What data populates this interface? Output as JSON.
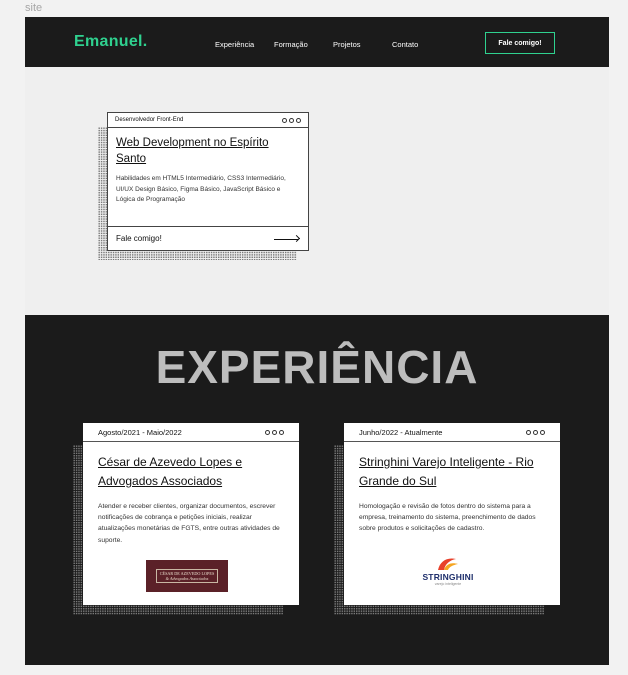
{
  "frame_label": "site",
  "header": {
    "logo": "Emanuel.",
    "nav": [
      "Experiência",
      "Formação",
      "Projetos",
      "Contato"
    ],
    "cta": "Fale comigo!"
  },
  "hero": {
    "tag": "Desenvolvedor Front-End",
    "title": "Web Development no Espírito Santo",
    "description": "Habilidades em HTML5 Intermediário, CSS3 Intermediário, UI/UX Design Básico, Figma Básico, JavaScript Básico e Lógica de Programação",
    "cta": "Fale comigo!"
  },
  "experience": {
    "heading": "EXPERIÊNCIA",
    "items": [
      {
        "period": "Agosto/2021 - Maio/2022",
        "title": "César de Azevedo Lopes e Advogados Associados",
        "description": "Atender e receber clientes, organizar documentos, escrever notificações de cobrança e petições iniciais, realizar atualizações monetárias de FGTS, entre outras atividades de suporte.",
        "logo_lines": [
          "CÉSAR DE AZEVEDO LOPES",
          "& Advogados Associados"
        ]
      },
      {
        "period": "Junho/2022 - Atualmente",
        "title": "Stringhini Varejo Inteligente - Rio Grande do Sul",
        "description": "Homologação e revisão de fotos dentro do sistema para a empresa, treinamento do sistema, preenchimento de dados sobre produtos e solicitações de cadastro.",
        "logo_name": "STRINGHINI",
        "logo_sub": "varejo inteligente"
      }
    ]
  },
  "colors": {
    "accent": "#2fd18f",
    "dark_bg": "#1b1b1b",
    "light_bg": "#efefef"
  }
}
